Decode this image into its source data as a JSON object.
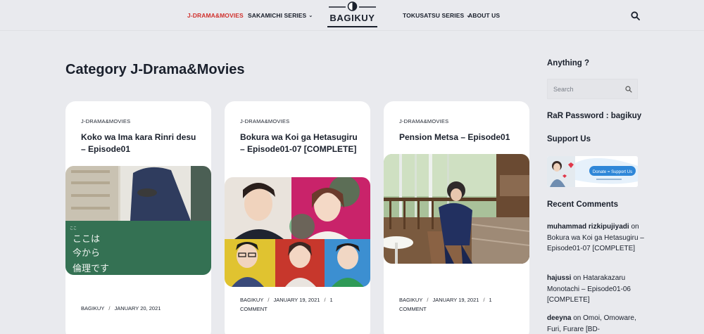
{
  "nav": {
    "items": [
      {
        "label": "J-DRAMA&MOVIES",
        "active": true,
        "dropdown": false
      },
      {
        "label": "SAKAMICHI SERIES",
        "active": false,
        "dropdown": true
      },
      {
        "label": "TOKUSATSU SERIES",
        "active": false,
        "dropdown": true
      },
      {
        "label": "ABOUT US",
        "active": false,
        "dropdown": false
      }
    ],
    "logo_text": "BAGIKUY",
    "search_icon": "search-icon",
    "accent_color": "#d0312d"
  },
  "page": {
    "title": "Category J-Drama&Movies"
  },
  "posts": [
    {
      "category": "J-DRAMA&MOVIES",
      "title": "Koko wa Ima kara Rinri desu – Episode01",
      "author": "BAGIKUY",
      "date": "JANUARY 20, 2021",
      "comments": "",
      "image_text": [
        "ここは",
        "今から",
        "倫理です"
      ]
    },
    {
      "category": "J-DRAMA&MOVIES",
      "title": "Bokura wa Koi ga Hetasugiru – Episode01-07 [COMPLETE]",
      "author": "BAGIKUY",
      "date": "JANUARY 19, 2021",
      "comments": "1 COMMENT"
    },
    {
      "category": "J-DRAMA&MOVIES",
      "title": "Pension Metsa – Episode01",
      "author": "BAGIKUY",
      "date": "JANUARY 19, 2021",
      "comments": "1 COMMENT"
    }
  ],
  "sidebar": {
    "search_heading": "Anything ?",
    "search_placeholder": "Search",
    "password_heading": "RaR Password : bagikuy",
    "support_heading": "Support Us",
    "donate_text": "Donate = Support Us",
    "recent_heading": "Recent Comments",
    "comments": [
      {
        "author": "muhammad rizkipujiyadi",
        "on": "on",
        "post": "Bokura wa Koi ga Hetasugiru – Episode01-07 [COMPLETE]"
      },
      {
        "author": "hajussi",
        "on": "on",
        "post": "Hatarakazaru Monotachi – Episode01-06 [COMPLETE]"
      },
      {
        "author": "deeyna",
        "on": "on",
        "post": "Omoi, Omoware, Furi, Furare [BD-"
      }
    ]
  }
}
